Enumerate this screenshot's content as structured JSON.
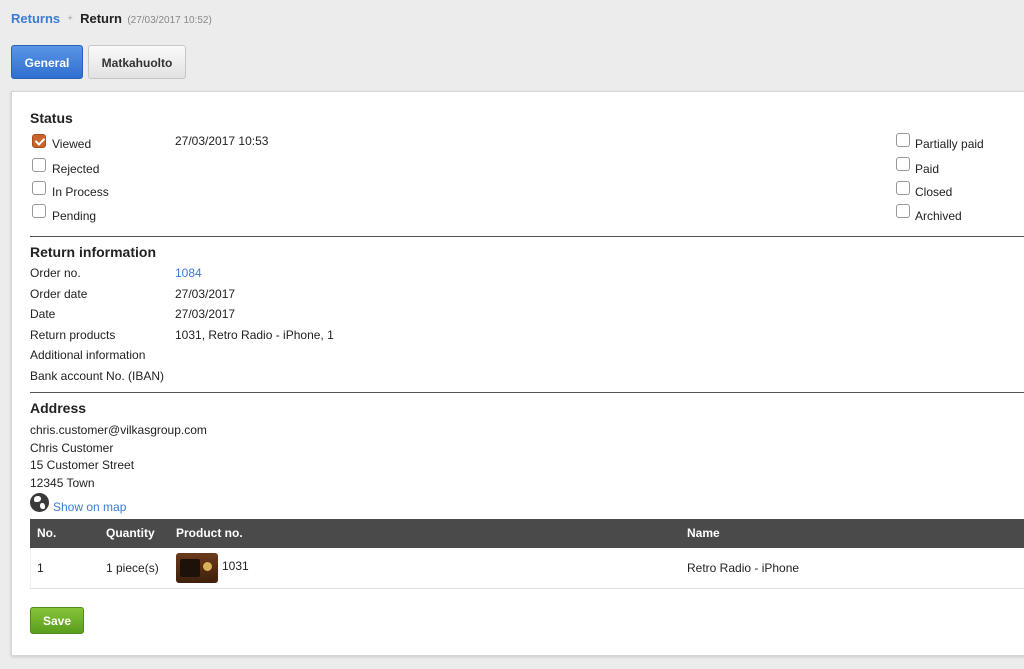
{
  "breadcrumb": {
    "parent": "Returns",
    "separator": "+",
    "title": "Return",
    "timestamp": "(27/03/2017 10:52)"
  },
  "tabs": [
    {
      "label": "General",
      "active": true
    },
    {
      "label": "Matkahuolto",
      "active": false
    }
  ],
  "status": {
    "title": "Status",
    "viewed_time": "27/03/2017 10:53",
    "left": [
      {
        "label": "Viewed",
        "checked": true
      },
      {
        "label": "Rejected",
        "checked": false
      },
      {
        "label": "In Process",
        "checked": false
      },
      {
        "label": "Pending",
        "checked": false
      }
    ],
    "right": [
      {
        "label": "Partially paid",
        "checked": false
      },
      {
        "label": "Paid",
        "checked": false
      },
      {
        "label": "Closed",
        "checked": false
      },
      {
        "label": "Archived",
        "checked": false
      }
    ]
  },
  "return_info": {
    "title": "Return information",
    "rows": [
      {
        "label": "Order no.",
        "value": "1084",
        "link": true
      },
      {
        "label": "Order date",
        "value": "27/03/2017",
        "link": false
      },
      {
        "label": "Date",
        "value": "27/03/2017",
        "link": false
      },
      {
        "label": "Return products",
        "value": "1031, Retro Radio - iPhone, 1",
        "link": false
      },
      {
        "label": "Additional information",
        "value": "",
        "link": false
      },
      {
        "label": "Bank account No. (IBAN)",
        "value": "",
        "link": false
      }
    ]
  },
  "address": {
    "title": "Address",
    "lines": [
      "chris.customer@vilkasgroup.com",
      "Chris Customer",
      "15 Customer Street",
      "12345 Town"
    ],
    "map_link": "Show on map"
  },
  "table": {
    "headers": [
      "No.",
      "Quantity",
      "Product no.",
      "Name"
    ],
    "rows": [
      {
        "no": "1",
        "quantity": "1 piece(s)",
        "product_no": "1031",
        "name": "Retro Radio - iPhone"
      }
    ]
  },
  "actions": {
    "save_label": "Save"
  },
  "colors": {
    "accent": "#3a7bd5",
    "save": "#6bb02a",
    "checked": "#c8642e",
    "table_header": "#4a4a4a"
  }
}
